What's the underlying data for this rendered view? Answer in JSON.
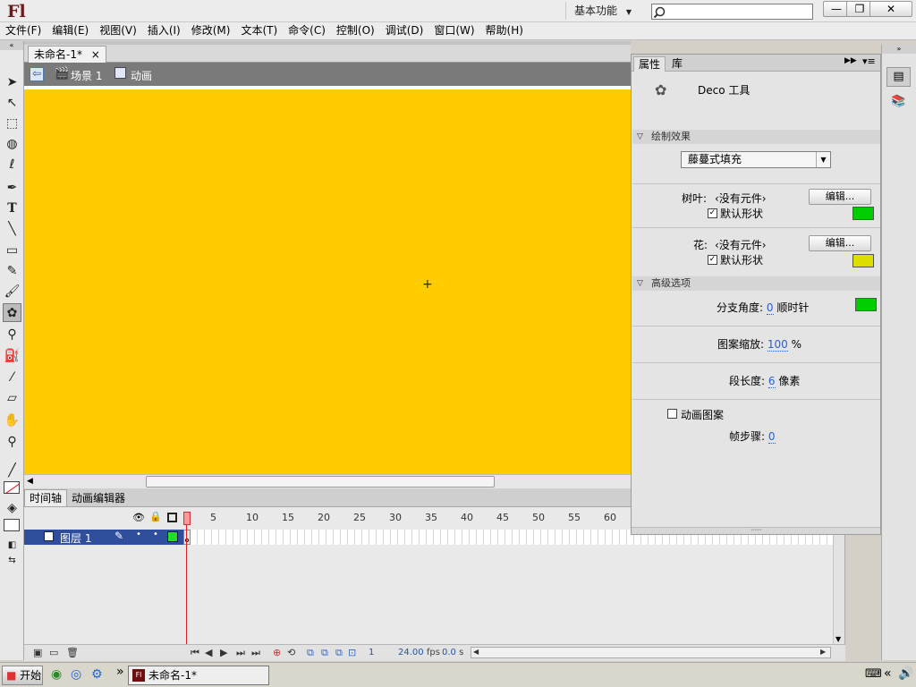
{
  "app": {
    "logo": "Fl"
  },
  "titlebar": {
    "workspace": "基本功能",
    "search_placeholder": "",
    "min": "—",
    "max": "❐",
    "close": "✕"
  },
  "menu": [
    "文件(F)",
    "编辑(E)",
    "视图(V)",
    "插入(I)",
    "修改(M)",
    "文本(T)",
    "命令(C)",
    "控制(O)",
    "调试(D)",
    "窗口(W)",
    "帮助(H)"
  ],
  "document": {
    "tab": "未命名-1*",
    "tab_close": "×",
    "scene": "场景 1",
    "symbol": "动画"
  },
  "timeline": {
    "tab_timeline": "时间轴",
    "tab_motion": "动画编辑器",
    "ticks": [
      "1",
      "5",
      "10",
      "15",
      "20",
      "25",
      "30",
      "35",
      "40",
      "45",
      "50",
      "55",
      "60"
    ],
    "layer_name": "图层 1",
    "frame": "1",
    "fps": "24.00",
    "fps_unit": "fps",
    "time": "0.0",
    "time_unit": "s"
  },
  "props": {
    "tab_properties": "属性",
    "tab_library": "库",
    "tool_name": "Deco 工具",
    "section_draw": "绘制效果",
    "effect_select": "藤蔓式填充",
    "leaf_label": "树叶:",
    "leaf_value": "‹没有元件›",
    "edit_button": "编辑...",
    "default_shape": "默认形状",
    "flower_label": "花:",
    "flower_value": "‹没有元件›",
    "section_advanced": "高级选项",
    "branch_angle_label": "分支角度:",
    "branch_angle_value": "0",
    "branch_dir": "顺时针",
    "pattern_scale_label": "图案缩放:",
    "pattern_scale_value": "100",
    "pattern_scale_unit": "%",
    "segment_length_label": "段长度:",
    "segment_length_value": "6",
    "segment_length_unit": "像素",
    "animate_pattern": "动画图案",
    "frame_step_label": "帧步骤:",
    "frame_step_value": "0",
    "leaf_color": "#00cc00",
    "flower_color": "#dddd00",
    "branch_color": "#00cc00"
  },
  "stage_color": "#ffcc00",
  "taskbar": {
    "start": "开始",
    "more": "»",
    "task": "未命名-1*"
  }
}
